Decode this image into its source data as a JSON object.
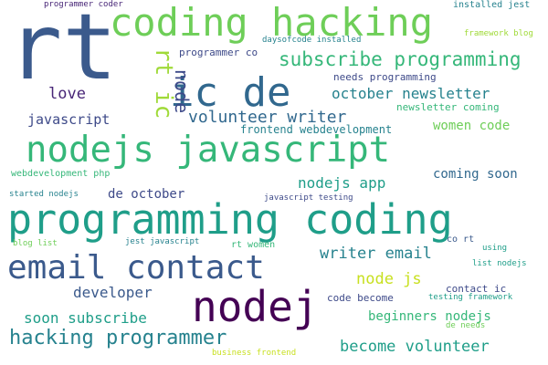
{
  "colors": {
    "background": "#ffffff",
    "dark_purple": "#440154",
    "purple": "#482677",
    "indigo": "#3e4a89",
    "slate_blue": "#3b5a8c",
    "blue": "#31688e",
    "teal_blue": "#26828e",
    "teal": "#1f9e89",
    "green": "#35b779",
    "light_green": "#6ece58",
    "lime": "#a0da39",
    "yellow_green": "#c8e020"
  },
  "words": [
    {
      "text": "rt"
    },
    {
      "text": "coding hacking"
    },
    {
      "text": "ic de"
    },
    {
      "text": "rt ic"
    },
    {
      "text": "node"
    },
    {
      "text": "subscribe programming"
    },
    {
      "text": "programmer co"
    },
    {
      "text": "needs programming"
    },
    {
      "text": "love"
    },
    {
      "text": "october newsletter"
    },
    {
      "text": "newsletter coming"
    },
    {
      "text": "volunteer writer"
    },
    {
      "text": "javascript"
    },
    {
      "text": "women code"
    },
    {
      "text": "frontend webdevelopment"
    },
    {
      "text": "nodejs javascript"
    },
    {
      "text": "coming soon"
    },
    {
      "text": "webdevelopment php"
    },
    {
      "text": "nodejs app"
    },
    {
      "text": "framework blog"
    },
    {
      "text": "installed jest"
    },
    {
      "text": "programmer coder"
    },
    {
      "text": "daysofcode installed"
    },
    {
      "text": "de october"
    },
    {
      "text": "started nodejs"
    },
    {
      "text": "javascript testing"
    },
    {
      "text": "programming coding"
    },
    {
      "text": "blog list"
    },
    {
      "text": "jest javascript"
    },
    {
      "text": "rt women"
    },
    {
      "text": "co rt"
    },
    {
      "text": "using"
    },
    {
      "text": "list nodejs"
    },
    {
      "text": "writer email"
    },
    {
      "text": "email contact"
    },
    {
      "text": "node js"
    },
    {
      "text": "developer"
    },
    {
      "text": "contact ic"
    },
    {
      "text": "testing framework"
    },
    {
      "text": "nodej"
    },
    {
      "text": "code become"
    },
    {
      "text": "beginners nodejs"
    },
    {
      "text": "de needs"
    },
    {
      "text": "soon subscribe"
    },
    {
      "text": "hacking programmer"
    },
    {
      "text": "become volunteer"
    },
    {
      "text": "business frontend"
    }
  ]
}
